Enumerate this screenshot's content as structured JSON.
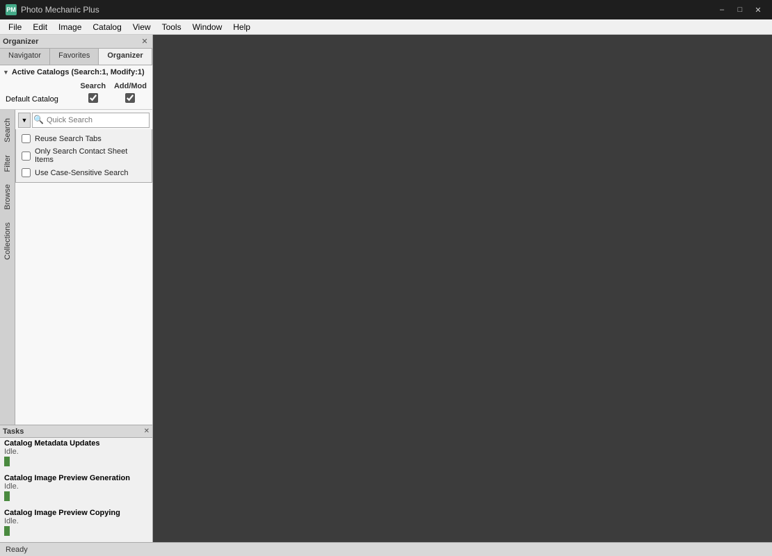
{
  "window": {
    "title": "Photo Mechanic Plus",
    "icon": "PM"
  },
  "titlebar": {
    "minimize": "–",
    "maximize": "□",
    "close": "✕"
  },
  "menubar": {
    "items": [
      "File",
      "Edit",
      "Image",
      "Catalog",
      "View",
      "Tools",
      "Window",
      "Help"
    ]
  },
  "organizer": {
    "title": "Organizer",
    "close_icon": "✕"
  },
  "tabs": {
    "items": [
      "Navigator",
      "Favorites",
      "Organizer"
    ],
    "active": "Organizer"
  },
  "catalog_section": {
    "header": "Active Catalogs (Search:1, Modify:1)",
    "col_search": "Search",
    "col_addmod": "Add/Mod",
    "rows": [
      {
        "label": "Default Catalog",
        "search_checked": true,
        "addmod_checked": true
      }
    ]
  },
  "vertical_tabs": [
    "Search",
    "Filter",
    "Browse",
    "Collections"
  ],
  "search": {
    "placeholder": "Quick Search",
    "dropdown_open": true,
    "options": [
      {
        "label": "Reuse Search Tabs",
        "checked": false
      },
      {
        "label": "Only Search Contact Sheet Items",
        "checked": false
      },
      {
        "label": "Use Case-Sensitive Search",
        "checked": false
      }
    ]
  },
  "tasks": {
    "title": "Tasks",
    "close_icon": "✕",
    "items": [
      {
        "name": "Catalog Metadata Updates",
        "status": "Idle."
      },
      {
        "name": "Catalog Image Preview Generation",
        "status": "Idle."
      },
      {
        "name": "Catalog Image Preview Copying",
        "status": "Idle."
      }
    ]
  },
  "statusbar": {
    "text": "Ready"
  }
}
